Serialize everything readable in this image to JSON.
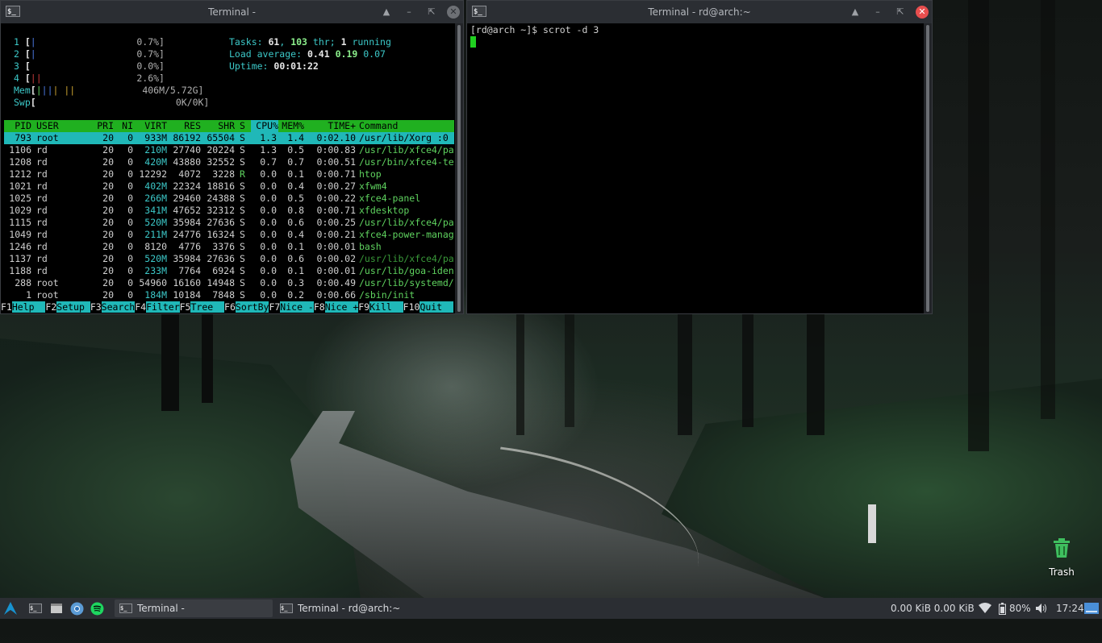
{
  "term1": {
    "title": "Terminal -",
    "cpu": [
      {
        "n": "1",
        "pct": "0.7%]"
      },
      {
        "n": "2",
        "pct": "0.7%]"
      },
      {
        "n": "3",
        "pct": "0.0%]"
      },
      {
        "n": "4",
        "pct": "2.6%]"
      }
    ],
    "mem_label": "Mem",
    "mem_val": "406M/5.72G]",
    "swp_label": "Swp",
    "swp_val": "0K/0K]",
    "tasks_label": "Tasks:",
    "tasks": "61",
    "thr": "103",
    "thr_label": "thr;",
    "running": "1",
    "running_label": "running",
    "load_label": "Load average:",
    "load1": "0.41",
    "load2": "0.19",
    "load3": "0.07",
    "uptime_label": "Uptime:",
    "uptime": "00:01:22",
    "header": {
      "pid": " PID",
      "user": "USER",
      "pri": "PRI",
      "ni": "NI",
      "virt": "VIRT",
      "res": "RES",
      "shr": "SHR",
      "s": "S",
      "cpu": "CPU%",
      "mem": "MEM%",
      "time": "TIME+",
      "cmd": "Command"
    },
    "processes": [
      {
        "pid": "793",
        "user": "root",
        "pri": "20",
        "ni": "0",
        "virt": "933M",
        "res": "86192",
        "shr": "65504",
        "s": "S",
        "cpu": "1.3",
        "mem": "1.4",
        "time": "0:02.10",
        "cmd": "/usr/lib/Xorg :0"
      },
      {
        "pid": "1106",
        "user": "rd",
        "pri": "20",
        "ni": "0",
        "virt": "210M",
        "res": "27740",
        "shr": "20224",
        "s": "S",
        "cpu": "1.3",
        "mem": "0.5",
        "time": "0:00.83",
        "cmd": "/usr/lib/xfce4/pa"
      },
      {
        "pid": "1208",
        "user": "rd",
        "pri": "20",
        "ni": "0",
        "virt": "420M",
        "res": "43880",
        "shr": "32552",
        "s": "S",
        "cpu": "0.7",
        "mem": "0.7",
        "time": "0:00.51",
        "cmd": "/usr/bin/xfce4-te"
      },
      {
        "pid": "1212",
        "user": "rd",
        "pri": "20",
        "ni": "0",
        "virt": "12292",
        "res": "4072",
        "shr": "3228",
        "s": "R",
        "cpu": "0.0",
        "mem": "0.1",
        "time": "0:00.71",
        "cmd": "htop"
      },
      {
        "pid": "1021",
        "user": "rd",
        "pri": "20",
        "ni": "0",
        "virt": "402M",
        "res": "22324",
        "shr": "18816",
        "s": "S",
        "cpu": "0.0",
        "mem": "0.4",
        "time": "0:00.27",
        "cmd": "xfwm4"
      },
      {
        "pid": "1025",
        "user": "rd",
        "pri": "20",
        "ni": "0",
        "virt": "266M",
        "res": "29460",
        "shr": "24388",
        "s": "S",
        "cpu": "0.0",
        "mem": "0.5",
        "time": "0:00.22",
        "cmd": "xfce4-panel"
      },
      {
        "pid": "1029",
        "user": "rd",
        "pri": "20",
        "ni": "0",
        "virt": "341M",
        "res": "47652",
        "shr": "32312",
        "s": "S",
        "cpu": "0.0",
        "mem": "0.8",
        "time": "0:00.71",
        "cmd": "xfdesktop"
      },
      {
        "pid": "1115",
        "user": "rd",
        "pri": "20",
        "ni": "0",
        "virt": "520M",
        "res": "35984",
        "shr": "27636",
        "s": "S",
        "cpu": "0.0",
        "mem": "0.6",
        "time": "0:00.25",
        "cmd": "/usr/lib/xfce4/pa"
      },
      {
        "pid": "1049",
        "user": "rd",
        "pri": "20",
        "ni": "0",
        "virt": "211M",
        "res": "24776",
        "shr": "16324",
        "s": "S",
        "cpu": "0.0",
        "mem": "0.4",
        "time": "0:00.21",
        "cmd": "xfce4-power-manag"
      },
      {
        "pid": "1246",
        "user": "rd",
        "pri": "20",
        "ni": "0",
        "virt": "8120",
        "res": "4776",
        "shr": "3376",
        "s": "S",
        "cpu": "0.0",
        "mem": "0.1",
        "time": "0:00.01",
        "cmd": "bash"
      },
      {
        "pid": "1137",
        "user": "rd",
        "pri": "20",
        "ni": "0",
        "virt": "520M",
        "res": "35984",
        "shr": "27636",
        "s": "S",
        "cpu": "0.0",
        "mem": "0.6",
        "time": "0:00.02",
        "cmd": "/usr/lib/xfce4/pa"
      },
      {
        "pid": "1188",
        "user": "rd",
        "pri": "20",
        "ni": "0",
        "virt": "233M",
        "res": "7764",
        "shr": "6924",
        "s": "S",
        "cpu": "0.0",
        "mem": "0.1",
        "time": "0:00.01",
        "cmd": "/usr/lib/goa-iden"
      },
      {
        "pid": "288",
        "user": "root",
        "pri": "20",
        "ni": "0",
        "virt": "54960",
        "res": "16160",
        "shr": "14948",
        "s": "S",
        "cpu": "0.0",
        "mem": "0.3",
        "time": "0:00.49",
        "cmd": "/usr/lib/systemd/"
      },
      {
        "pid": "1",
        "user": "root",
        "pri": "20",
        "ni": "0",
        "virt": "184M",
        "res": "10184",
        "shr": "7848",
        "s": "S",
        "cpu": "0.0",
        "mem": "0.2",
        "time": "0:00.66",
        "cmd": "/sbin/init"
      }
    ],
    "fkeys": [
      {
        "k": "F1",
        "l": "Help  "
      },
      {
        "k": "F2",
        "l": "Setup "
      },
      {
        "k": "F3",
        "l": "Search"
      },
      {
        "k": "F4",
        "l": "Filter"
      },
      {
        "k": "F5",
        "l": "Tree  "
      },
      {
        "k": "F6",
        "l": "SortBy"
      },
      {
        "k": "F7",
        "l": "Nice -"
      },
      {
        "k": "F8",
        "l": "Nice +"
      },
      {
        "k": "F9",
        "l": "Kill  "
      },
      {
        "k": "F10",
        "l": "Quit  "
      }
    ]
  },
  "term2": {
    "title": "Terminal - rd@arch:~",
    "prompt": "[rd@arch ~]$ scrot -d 3"
  },
  "taskbar": {
    "task1": "Terminal -",
    "task2": "Terminal - rd@arch:~",
    "net": "0.00 KiB 0.00 KiB",
    "battery": "80%",
    "clock": "17:24"
  },
  "desktop": {
    "trash_label": "Trash"
  },
  "colors": {
    "htop_header": "#20b020",
    "htop_selection": "#20b8b8",
    "close_active": "#e84e4e",
    "panel": "#2b2e33"
  }
}
